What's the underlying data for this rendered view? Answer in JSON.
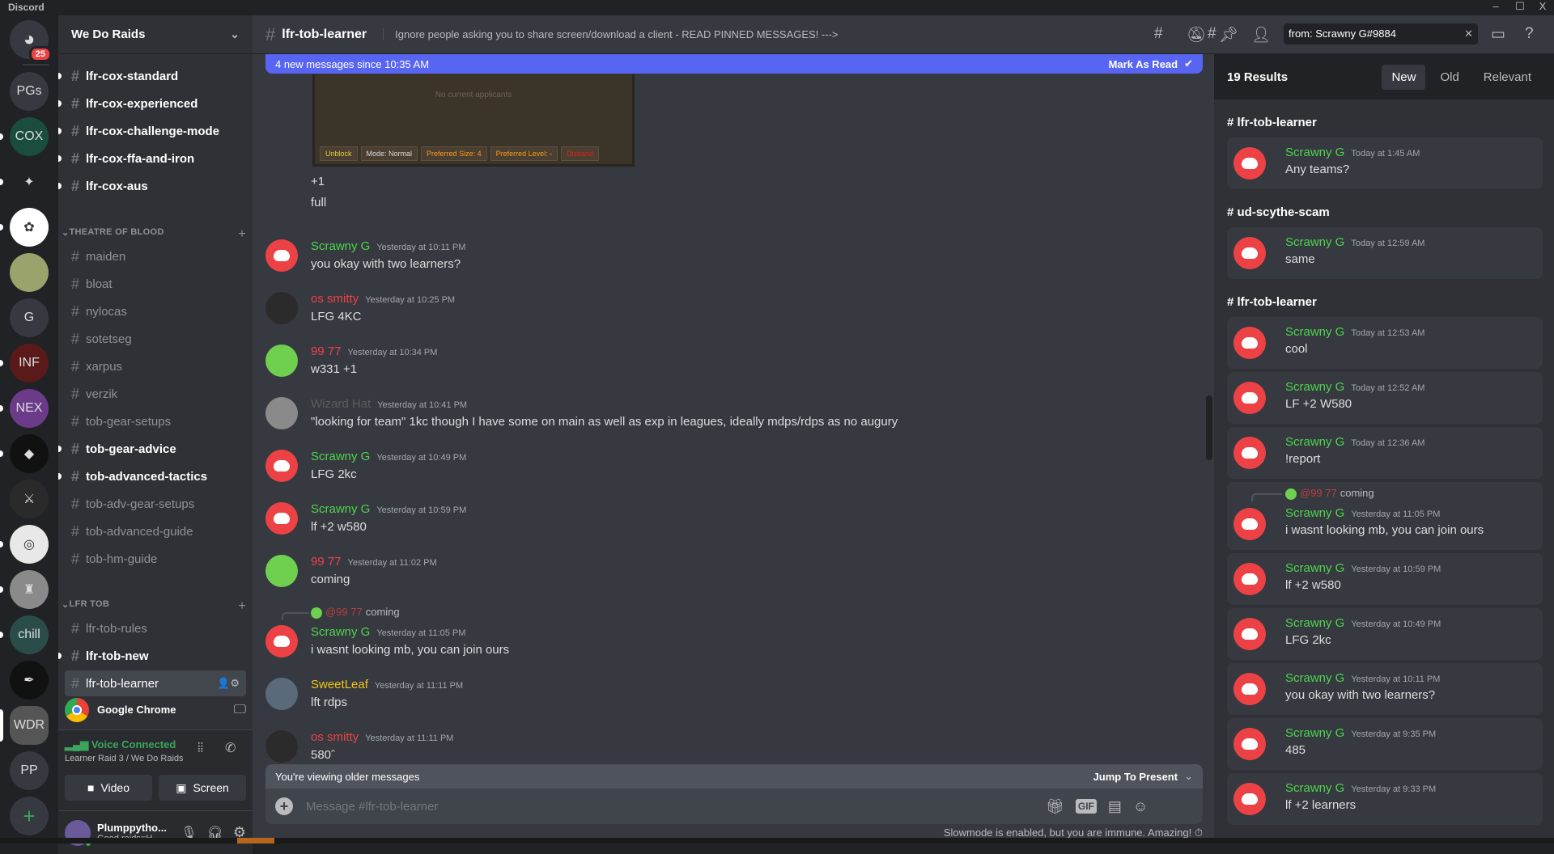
{
  "app": {
    "title": "Discord",
    "window_controls": [
      "–",
      "☐",
      "X"
    ]
  },
  "colors": {
    "blurple": "#5865f2",
    "scrawny": "#4fd44f",
    "red": "#ed4245",
    "wizard": "#5c5c5c",
    "sweetleaf": "#f0c419"
  },
  "servers": [
    {
      "label": "",
      "icon": "discord-home-icon",
      "color": "#36393f",
      "badge": "25"
    },
    {
      "label": "PGs",
      "color": "#36393f"
    },
    {
      "label": "COX",
      "color": "#1b4d3e",
      "unread": true
    },
    {
      "label": "✦",
      "color": "#202225",
      "unread": true
    },
    {
      "label": "✿",
      "color": "#ffffff",
      "unread": true
    },
    {
      "label": "",
      "color": "#9aa36b"
    },
    {
      "label": "G",
      "color": "#36393f"
    },
    {
      "label": "INF",
      "color": "#5a1a1a",
      "unread": true
    },
    {
      "label": "NEX",
      "color": "#6b3b8a",
      "unread": true
    },
    {
      "label": "◆",
      "color": "#111111",
      "unread": true
    },
    {
      "label": "⚔",
      "color": "#2a2a2a"
    },
    {
      "label": "◎",
      "color": "#e8e8e8",
      "unread": true
    },
    {
      "label": "♜",
      "color": "#8a8a8a",
      "unread": true
    },
    {
      "label": "chill",
      "color": "#2a4d4a",
      "unread": true
    },
    {
      "label": "✒",
      "color": "#111111"
    },
    {
      "label": "WDR",
      "color": "#555555",
      "selected": true
    },
    {
      "label": "PP",
      "color": "#36393f"
    }
  ],
  "add_server": "+",
  "server_name": "We Do Raids",
  "channels_top": [
    {
      "name": "lfr-cox-standard",
      "unread": true
    },
    {
      "name": "lfr-cox-experienced",
      "unread": true
    },
    {
      "name": "lfr-cox-challenge-mode",
      "unread": true
    },
    {
      "name": "lfr-cox-ffa-and-iron",
      "unread": true
    },
    {
      "name": "lfr-cox-aus",
      "unread": true
    }
  ],
  "categories": [
    {
      "name": "THEATRE OF BLOOD",
      "channels": [
        {
          "name": "maiden"
        },
        {
          "name": "bloat"
        },
        {
          "name": "nylocas"
        },
        {
          "name": "sotetseg"
        },
        {
          "name": "xarpus"
        },
        {
          "name": "verzik"
        },
        {
          "name": "tob-gear-setups"
        },
        {
          "name": "tob-gear-advice",
          "unread": true
        },
        {
          "name": "tob-advanced-tactics",
          "unread": true
        },
        {
          "name": "tob-adv-gear-setups"
        },
        {
          "name": "tob-advanced-guide"
        },
        {
          "name": "tob-hm-guide"
        }
      ]
    },
    {
      "name": "LFR TOB",
      "channels": [
        {
          "name": "lfr-tob-rules"
        },
        {
          "name": "lfr-tob-new",
          "unread": true
        },
        {
          "name": "lfr-tob-learner",
          "selected": true
        }
      ]
    }
  ],
  "activity": {
    "app": "Google Chrome"
  },
  "voice": {
    "status": "Voice Connected",
    "location": "Learner Raid 3 / We Do Raids",
    "video": "Video",
    "screen": "Screen"
  },
  "user": {
    "name": "Plumppytho...",
    "status": "Good raids=H..."
  },
  "channel": {
    "name": "lfr-tob-learner",
    "topic": "Ignore people asking you to share screen/download a client - READ PINNED MESSAGES! --->"
  },
  "search": {
    "value": "from: Scrawny G#9884"
  },
  "new_messages": {
    "text": "4 new messages since 10:35 AM",
    "action": "Mark As Read"
  },
  "attachment": {
    "empty_text": "No current applicants",
    "buttons": [
      "Unblock",
      "Mode: Normal",
      "Preferred Size: 4",
      "Preferred Level: -",
      "Disband"
    ]
  },
  "loose_lines": [
    "+1",
    "full"
  ],
  "messages": [
    {
      "author": "Scrawny G",
      "color": "#4fd44f",
      "avatar": "discord",
      "time": "Yesterday at 10:11 PM",
      "text": "you okay with two learners?"
    },
    {
      "author": "os smitty",
      "color": "#ed4245",
      "avatar": "#2b2b2b",
      "time": "Yesterday at 10:25 PM",
      "text": "LFG 4KC"
    },
    {
      "author": "99 77",
      "color": "#ed4245",
      "avatar": "#6fcf4f",
      "time": "Yesterday at 10:34 PM",
      "text": "w331 +1"
    },
    {
      "author": "Wizard Hat",
      "color": "#5c5c5c",
      "avatar": "#8a8a8a",
      "time": "Yesterday at 10:41 PM",
      "text": "\"looking for team\" 1kc though I have some on main as well as exp in leagues, ideally mdps/rdps as no augury"
    },
    {
      "author": "Scrawny G",
      "color": "#4fd44f",
      "avatar": "discord",
      "time": "Yesterday at 10:49 PM",
      "text": "LFG 2kc"
    },
    {
      "author": "Scrawny G",
      "color": "#4fd44f",
      "avatar": "discord",
      "time": "Yesterday at 10:59 PM",
      "text": "lf +2 w580"
    },
    {
      "author": "99 77",
      "color": "#ed4245",
      "avatar": "#6fcf4f",
      "time": "Yesterday at 11:02 PM",
      "text": "coming"
    },
    {
      "author": "Scrawny G",
      "color": "#4fd44f",
      "avatar": "discord",
      "time": "Yesterday at 11:05 PM",
      "text": "i wasnt looking mb, you can join ours",
      "reply": {
        "author": "@99 77",
        "text": "coming"
      }
    },
    {
      "author": "SweetLeaf",
      "color": "#f0c419",
      "avatar": "#5a6a7a",
      "time": "Yesterday at 11:11 PM",
      "text": "lft rdps"
    },
    {
      "author": "os smitty",
      "color": "#ed4245",
      "avatar": "#2b2b2b",
      "time": "Yesterday at 11:11 PM",
      "text": "580ˆ"
    }
  ],
  "older_bar": {
    "text": "You're viewing older messages",
    "action": "Jump To Present"
  },
  "composer": {
    "placeholder": "Message #lfr-tob-learner"
  },
  "slowmode": "Slowmode is enabled, but you are immune. Amazing!",
  "results": {
    "count": "19 Results",
    "sort": [
      {
        "label": "New",
        "active": true
      },
      {
        "label": "Old"
      },
      {
        "label": "Relevant"
      }
    ],
    "groups": [
      {
        "channel": "lfr-tob-learner",
        "items": [
          {
            "author": "Scrawny G",
            "time": "Today at 1:45 AM",
            "text": "Any teams?"
          }
        ]
      },
      {
        "channel": "ud-scythe-scam",
        "items": [
          {
            "author": "Scrawny G",
            "time": "Today at 12:59 AM",
            "text": "same"
          }
        ]
      },
      {
        "channel": "lfr-tob-learner",
        "items": [
          {
            "author": "Scrawny G",
            "time": "Today at 12:53 AM",
            "text": "cool"
          },
          {
            "author": "Scrawny G",
            "time": "Today at 12:52 AM",
            "text": "LF +2 W580"
          },
          {
            "author": "Scrawny G",
            "time": "Today at 12:36 AM",
            "text": "!report"
          },
          {
            "author": "Scrawny G",
            "time": "Yesterday at 11:05 PM",
            "text": "i wasnt looking mb, you can join ours",
            "reply": {
              "author": "@99 77",
              "text": "coming"
            }
          },
          {
            "author": "Scrawny G",
            "time": "Yesterday at 10:59 PM",
            "text": "lf +2 w580"
          },
          {
            "author": "Scrawny G",
            "time": "Yesterday at 10:49 PM",
            "text": "LFG 2kc"
          },
          {
            "author": "Scrawny G",
            "time": "Yesterday at 10:11 PM",
            "text": "you okay with two learners?"
          },
          {
            "author": "Scrawny G",
            "time": "Yesterday at 9:35 PM",
            "text": "485"
          },
          {
            "author": "Scrawny G",
            "time": "Yesterday at 9:33 PM",
            "text": "lf +2 learners"
          }
        ]
      }
    ]
  }
}
